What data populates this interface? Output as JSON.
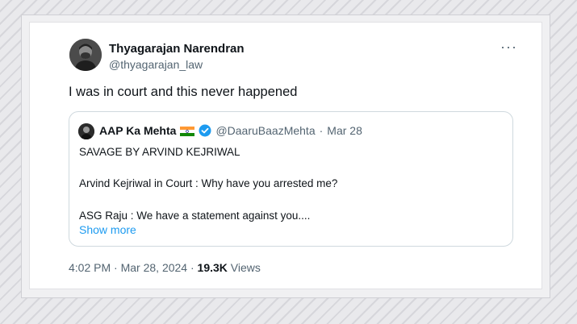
{
  "tweet": {
    "author_name": "Thyagarajan Narendran",
    "author_handle": "@thyagarajan_law",
    "more_label": "···",
    "text": "I was in court and this never happened",
    "time": "4:02 PM",
    "date": "Mar 28, 2024",
    "views_count": "19.3K",
    "views_label": "Views",
    "separator": "·"
  },
  "quote": {
    "author_name": "AAP Ka Mehta",
    "flag_icon": "india-flag-icon",
    "verified_icon": "verified-badge-icon",
    "author_handle": "@DaaruBaazMehta",
    "separator": "·",
    "date": "Mar 28",
    "line1": "SAVAGE BY ARVIND KEJRIWAL",
    "line2": "Arvind Kejriwal in Court : Why have you arrested me?",
    "line3": "ASG  Raju : We have a statement against you....",
    "show_more": "Show more"
  },
  "colors": {
    "link": "#1d9bf0",
    "muted": "#536471",
    "text": "#0f1419",
    "verified": "#1d9bf0"
  }
}
